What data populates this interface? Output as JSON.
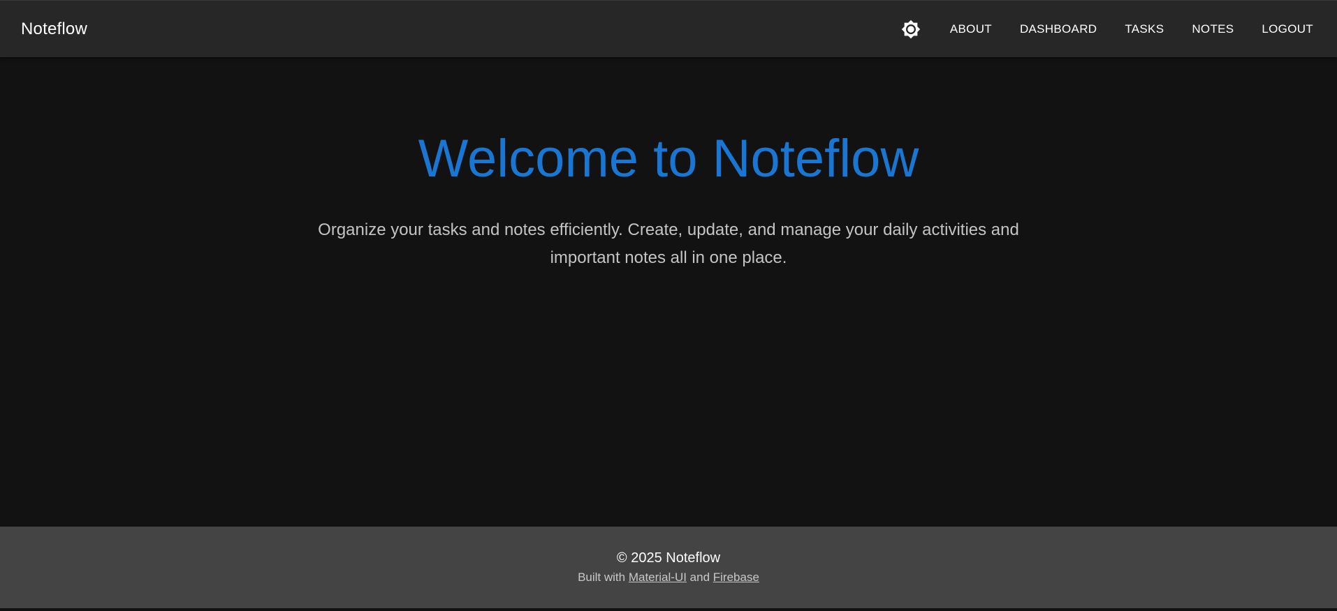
{
  "appbar": {
    "brand": "Noteflow",
    "theme_icon": "brightness-icon",
    "nav": [
      {
        "label": "ABOUT"
      },
      {
        "label": "DASHBOARD"
      },
      {
        "label": "TASKS"
      },
      {
        "label": "NOTES"
      },
      {
        "label": "LOGOUT"
      }
    ]
  },
  "hero": {
    "title": "Welcome to Noteflow",
    "subtitle_line1": "Organize your tasks and notes efficiently. Create, update, and manage your daily activities and",
    "subtitle_line2": "important notes all in one place."
  },
  "footer": {
    "copyright": "© 2025 Noteflow",
    "built_prefix": "Built with ",
    "link1": "Material-UI",
    "between": " and ",
    "link2": "Firebase"
  },
  "colors": {
    "accent": "#1976d2",
    "appbar_bg": "#272727",
    "page_bg": "#121212",
    "footer_bg": "#444444"
  }
}
